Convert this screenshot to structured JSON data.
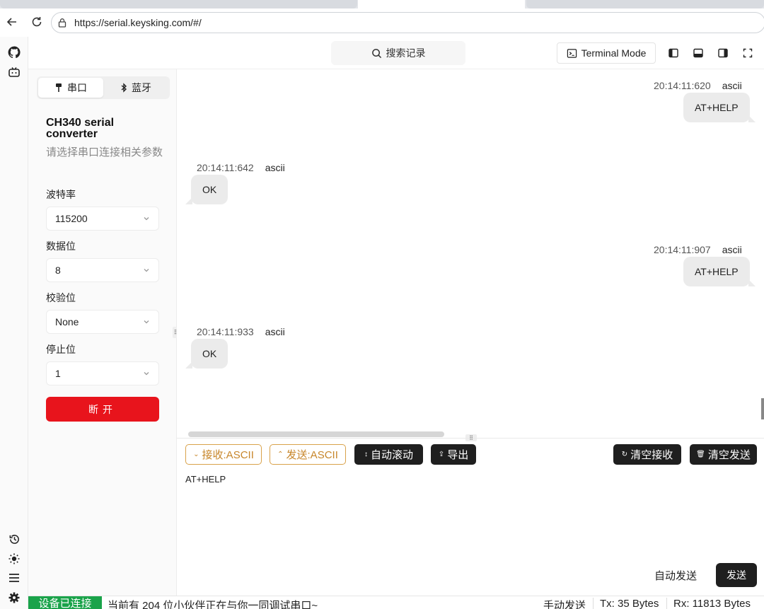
{
  "browser": {
    "url": "https://serial.keysking.com/#/"
  },
  "toolbar": {
    "search_label": "搜索记录",
    "terminal_mode_label": "Terminal Mode"
  },
  "panel": {
    "tabs": [
      {
        "label": "串口",
        "active": true
      },
      {
        "label": "蓝牙",
        "active": false
      }
    ],
    "device_name": "CH340 serial converter",
    "device_desc": "请选择串口连接相关参数",
    "fields": [
      {
        "label": "波特率",
        "value": "115200"
      },
      {
        "label": "数据位",
        "value": "8"
      },
      {
        "label": "校验位",
        "value": "None"
      },
      {
        "label": "停止位",
        "value": "1"
      }
    ],
    "disconnect_label": "断开"
  },
  "messages": [
    {
      "direction": "tx",
      "time": "20:14:11:620",
      "encoding": "ascii",
      "text": "AT+HELP"
    },
    {
      "direction": "rx",
      "time": "20:14:11:642",
      "encoding": "ascii",
      "text": "OK"
    },
    {
      "direction": "tx",
      "time": "20:14:11:907",
      "encoding": "ascii",
      "text": "AT+HELP"
    },
    {
      "direction": "rx",
      "time": "20:14:11:933",
      "encoding": "ascii",
      "text": "OK"
    }
  ],
  "controls": {
    "rx_format": "接收:ASCII",
    "tx_format": "发送:ASCII",
    "auto_scroll": "自动滚动",
    "export": "导出",
    "clear_rx": "清空接收",
    "clear_tx": "清空发送"
  },
  "input": {
    "value": "AT+HELP",
    "auto_send_label": "自动发送",
    "send_label": "发送"
  },
  "status": {
    "connection": "设备已连接",
    "message": "当前有 204 位小伙伴正在与你一同调试串口~",
    "mode": "手动发送",
    "tx": "Tx: 35 Bytes",
    "rx": "Rx: 11813 Bytes"
  },
  "colors": {
    "danger": "#e8141c",
    "success": "#1aa34a",
    "accent": "#c7862a",
    "dark": "#1f1f1f"
  }
}
